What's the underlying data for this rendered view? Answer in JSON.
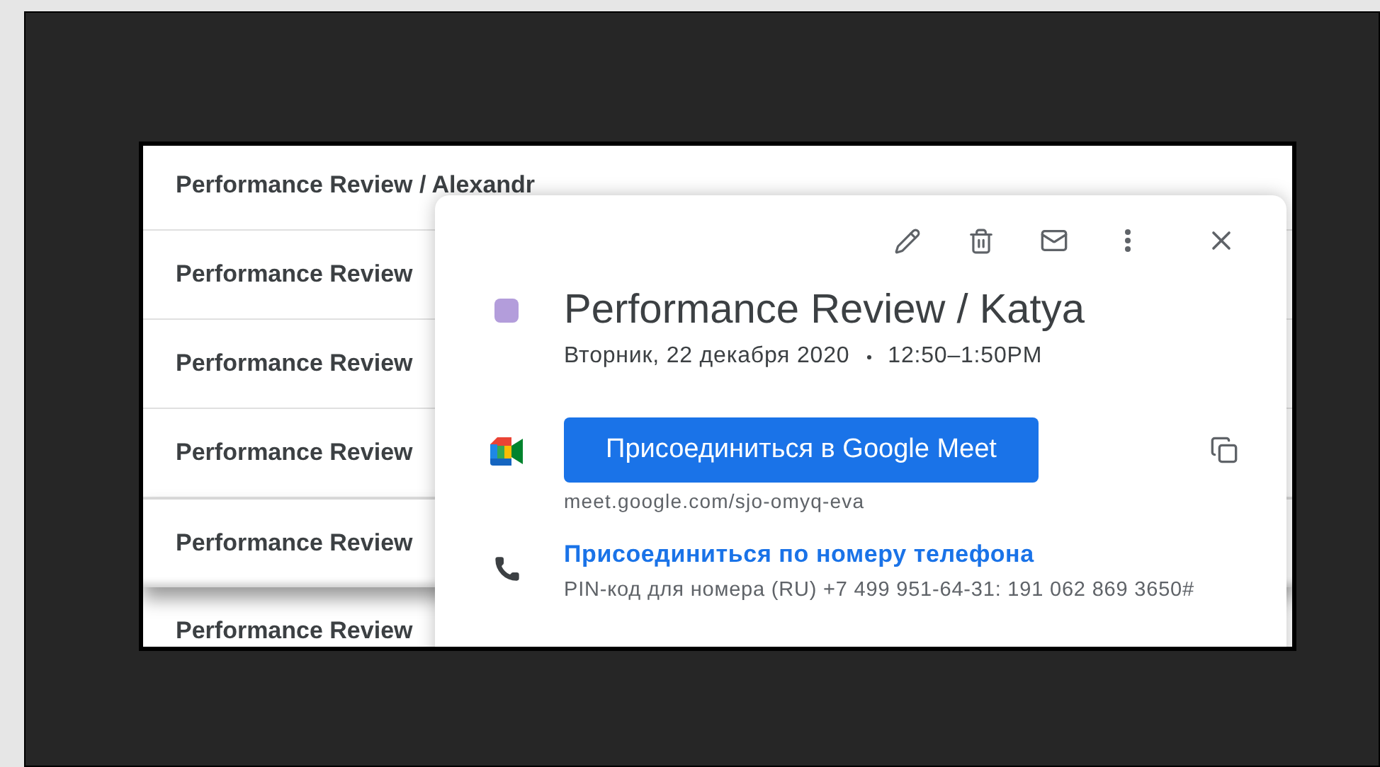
{
  "event_list": [
    {
      "title": "Performance Review / Alexandr",
      "selected": false
    },
    {
      "title": "Performance Review",
      "selected": false
    },
    {
      "title": "Performance Review",
      "selected": false
    },
    {
      "title": "Performance Review",
      "selected": false
    },
    {
      "title": "Performance Review",
      "selected": true
    },
    {
      "title": "Performance Review",
      "selected": false
    }
  ],
  "event_popup": {
    "color": "#b39ddb",
    "title": "Performance Review / Katya",
    "date": "Вторник, 22 декабря 2020",
    "time": "12:50–1:50PM",
    "meet_button": "Присоединиться в Google Meet",
    "meet_link": "meet.google.com/sjo-omyq-eva",
    "phone_link": "Присоединиться по номеру телефона",
    "phone_pin": "PIN-код для номера (RU) +7 499 951-64-31: 191 062 869 3650#"
  }
}
